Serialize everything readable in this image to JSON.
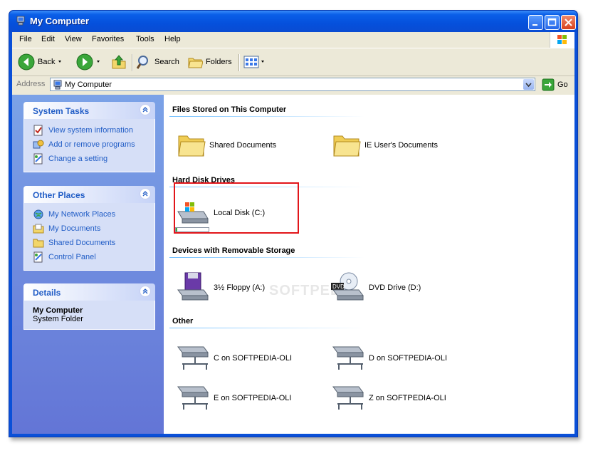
{
  "window": {
    "title": "My Computer"
  },
  "menu": {
    "items": [
      "File",
      "Edit",
      "View",
      "Favorites",
      "Tools",
      "Help"
    ]
  },
  "toolbar": {
    "back_label": "Back",
    "search_label": "Search",
    "folders_label": "Folders"
  },
  "address": {
    "label": "Address",
    "value": "My Computer",
    "go_label": "Go"
  },
  "sidebar": {
    "system_tasks": {
      "title": "System Tasks",
      "items": [
        "View system information",
        "Add or remove programs",
        "Change a setting"
      ]
    },
    "other_places": {
      "title": "Other Places",
      "items": [
        "My Network Places",
        "My Documents",
        "Shared Documents",
        "Control Panel"
      ]
    },
    "details": {
      "title": "Details",
      "name": "My Computer",
      "type": "System Folder"
    }
  },
  "content": {
    "files_group": {
      "title": "Files Stored on This Computer",
      "items": [
        "Shared Documents",
        "IE User's Documents"
      ]
    },
    "hdd_group": {
      "title": "Hard Disk Drives",
      "items": [
        "Local Disk (C:)"
      ],
      "c_usage_fraction": 0.04
    },
    "removable_group": {
      "title": "Devices with Removable Storage",
      "items": [
        "3½ Floppy (A:)",
        "DVD Drive (D:)"
      ]
    },
    "other_group": {
      "title": "Other",
      "items": [
        "C on SOFTPEDIA-OLI",
        "D on SOFTPEDIA-OLI",
        "E on SOFTPEDIA-OLI",
        "Z on SOFTPEDIA-OLI"
      ]
    }
  },
  "colors": {
    "title_bar": "#0550dc",
    "sidebar_link": "#215dc6",
    "highlight_box": "#e2151a"
  }
}
